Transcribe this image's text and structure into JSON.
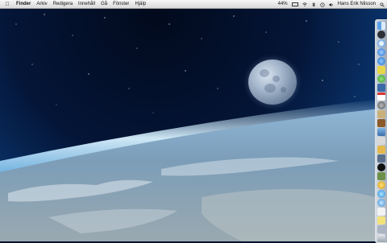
{
  "menubar": {
    "apple_icon": "apple-logo-icon",
    "app_name": "Finder",
    "menus": [
      "Arkiv",
      "Redigera",
      "Innehåll",
      "Gå",
      "Fönster",
      "Hjälp"
    ],
    "battery_percent": "44%",
    "user_name": "Hans Erik Nilsson",
    "status_icons": [
      "battery-icon",
      "wifi-icon",
      "volume-icon",
      "bluetooth-icon",
      "time-machine-icon",
      "spotlight-icon"
    ]
  },
  "desktop": {
    "wallpaper": "earth-moon-space",
    "colors": {
      "sky_top": "#041537",
      "atmosphere": "#8fd0ff",
      "earth": "#9fb6c8",
      "moon": "#a6b8cd"
    }
  },
  "dock": {
    "position": "right",
    "items": [
      "finder-icon",
      "dashboard-icon",
      "safari-icon",
      "itunes-icon",
      "app-store-icon",
      "messages-icon",
      "ichat-icon",
      "photo-icon",
      "calendar-icon",
      "system-preferences-icon",
      "preview-icon",
      "address-book-icon",
      "mail-icon",
      "terminal-icon",
      "textedit-icon",
      "utility-icon",
      "camera-icon",
      "applications-folder-icon",
      "notes-icon",
      "music-icon",
      "downloads-folder-icon",
      "document-icon",
      "stack-icon",
      "documents-folder-icon",
      "trash-icon"
    ]
  }
}
